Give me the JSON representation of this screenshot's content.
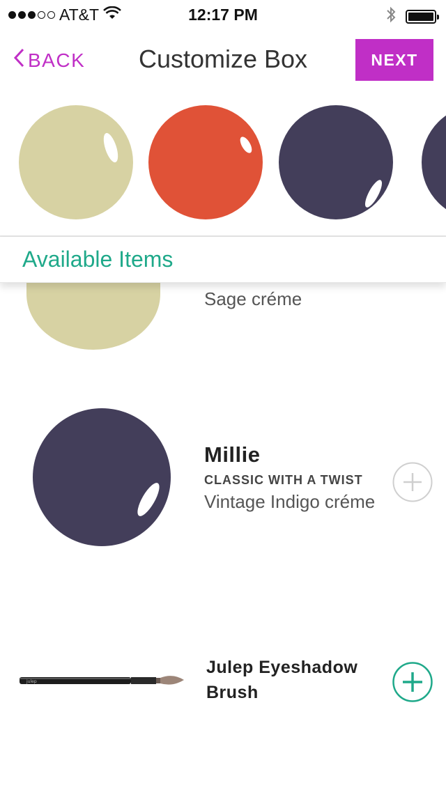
{
  "status_bar": {
    "carrier": "AT&T",
    "time": "12:17 PM",
    "signal_icon": "signal-dots-icon",
    "wifi_icon": "wifi-icon",
    "bluetooth_icon": "bluetooth-icon",
    "battery_icon": "battery-icon",
    "signal_bars_filled": 3,
    "signal_bars_total": 5
  },
  "nav": {
    "back_label": "BACK",
    "title": "Customize Box",
    "next_label": "NEXT",
    "accent_color": "#c02fc6"
  },
  "carousel": {
    "swatches": [
      {
        "name": "sage-swatch",
        "color": "#d7d2a3"
      },
      {
        "name": "red-orange-swatch",
        "color": "#e05237"
      },
      {
        "name": "indigo-swatch",
        "color": "#433e5a"
      },
      {
        "name": "indigo-swatch-partial",
        "color": "#433e5a"
      }
    ]
  },
  "available": {
    "title": "Available Items",
    "color": "#1fa98a"
  },
  "items": [
    {
      "description": "Sage créme",
      "color": "#d7d2a3"
    },
    {
      "name": "Millie",
      "collection": "CLASSIC WITH A TWIST",
      "description": "Vintage Indigo créme",
      "color": "#433e5a",
      "add_state": "disabled"
    },
    {
      "name": "Julep Eyeshadow Brush",
      "add_state": "enabled"
    }
  ]
}
